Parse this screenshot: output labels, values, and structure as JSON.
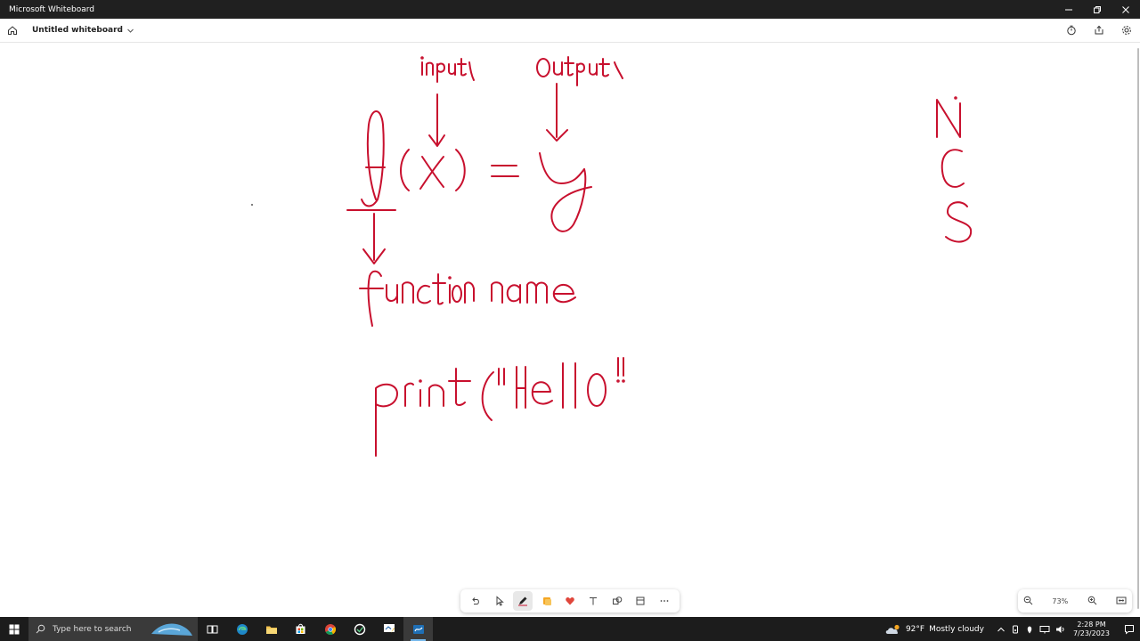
{
  "window": {
    "title": "Microsoft Whiteboard"
  },
  "appbar": {
    "doc_title": "Untitled whiteboard"
  },
  "zoom": {
    "level": "73%"
  },
  "taskbar": {
    "search_placeholder": "Type here to search",
    "weather_temp": "92°F",
    "weather_desc": "Mostly cloudy",
    "time": "2:28 PM",
    "date": "7/23/2023"
  },
  "colors": {
    "ink": "#c8102e",
    "titlebar": "#202020",
    "taskbar": "#1c1c1c",
    "accent": "#76b9ed"
  },
  "toolbar_icons": [
    "undo-icon",
    "select-icon",
    "pen-icon",
    "sticky-note-icon",
    "reaction-icon",
    "text-icon",
    "shapes-icon",
    "templates-icon",
    "more-icon"
  ],
  "ink_strokes": [
    "input",
    "Output",
    "f(x) = y",
    "function name",
    "Print(\"Hello\"",
    "N",
    "C",
    "S"
  ]
}
